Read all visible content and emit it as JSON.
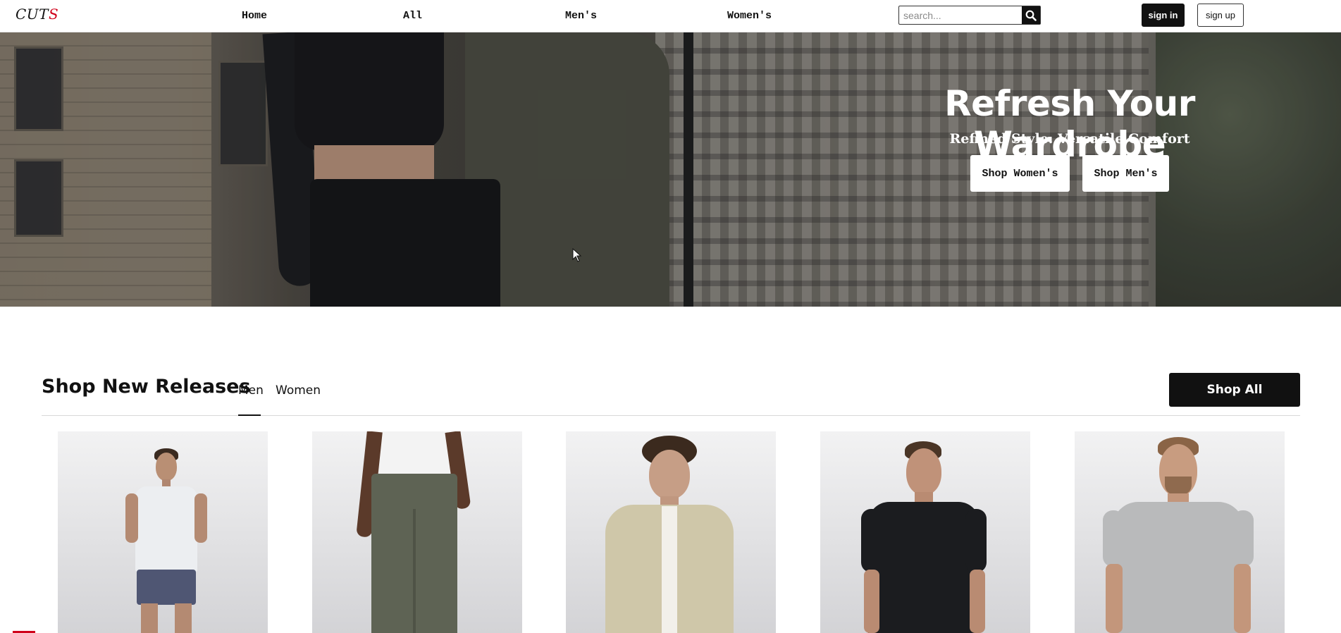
{
  "brand": {
    "logo_main": "CUT",
    "logo_accent": "S"
  },
  "nav": {
    "links": [
      "Home",
      "All",
      "Men's",
      "Women's"
    ]
  },
  "search": {
    "placeholder": "search..."
  },
  "auth": {
    "sign_in": "sign in",
    "sign_up": "sign up"
  },
  "hero": {
    "title": "Refresh Your Wardrobe",
    "subtitle": "Refined Style. Versatile Comfort",
    "buttons": [
      "Shop Women's",
      "Shop Men's"
    ]
  },
  "new_releases": {
    "title": "Shop New Releases",
    "tabs": [
      "Men",
      "Women"
    ],
    "active_tab": "Men",
    "shop_all": "Shop All",
    "products": [
      {
        "icon": "man-henley-shorts-image"
      },
      {
        "icon": "man-olive-pants-image"
      },
      {
        "icon": "man-beige-jacket-image"
      },
      {
        "icon": "man-black-polo-image"
      },
      {
        "icon": "man-grey-tee-image"
      }
    ]
  },
  "colors": {
    "primary": "#111111",
    "accent": "#d0021b",
    "surface": "#ffffff"
  }
}
